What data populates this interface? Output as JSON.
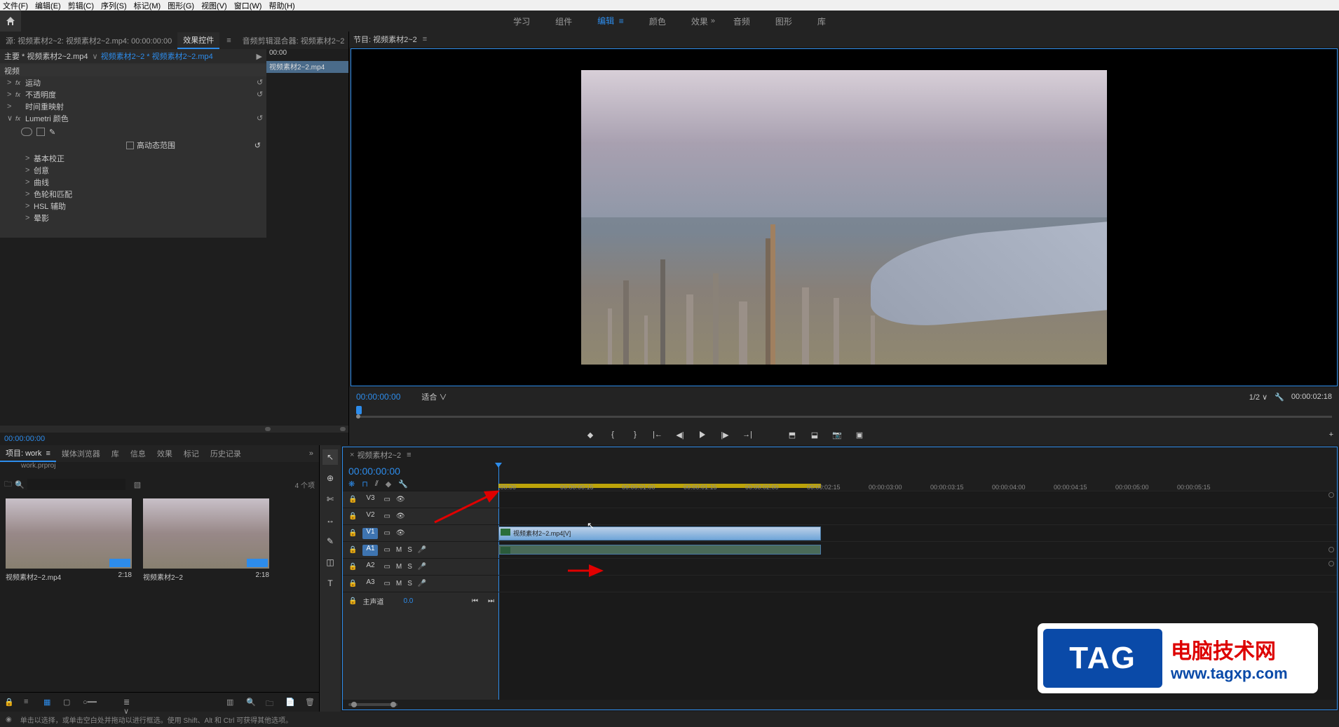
{
  "menubar": [
    "文件(F)",
    "编辑(E)",
    "剪辑(C)",
    "序列(S)",
    "标记(M)",
    "图形(G)",
    "视图(V)",
    "窗口(W)",
    "帮助(H)"
  ],
  "workspaces": {
    "items": [
      "学习",
      "组件",
      "编辑",
      "颜色",
      "效果",
      "音频",
      "图形",
      "库"
    ],
    "active": "编辑",
    "more": "»"
  },
  "source_tabs": {
    "source": "源: 视频素材2~2: 视频素材2~2.mp4: 00:00:00:00",
    "effect": "效果控件",
    "mixer": "音频剪辑混合器: 视频素材2~2",
    "more": "»"
  },
  "effect_header": {
    "master": "主要 * 视频素材2~2.mp4",
    "chevron": "∨",
    "link": "视频素材2~2 * 视频素材2~2.mp4",
    "play": "▶"
  },
  "side_tc": "00:00",
  "side_clip": "视频素材2~2.mp4",
  "effects": {
    "video_section": "视频",
    "rows": [
      {
        "fx": "fx",
        "label": "运动",
        "reset": "↺"
      },
      {
        "fx": "fx",
        "label": "不透明度",
        "reset": "↺"
      },
      {
        "fx": "",
        "label": "时间重映射"
      },
      {
        "fx": "fx",
        "label": "Lumetri 颜色",
        "reset": "↺",
        "expanded": true
      }
    ],
    "hdr_checkbox": "高动态范围",
    "hdr_reset": "↺",
    "lumetri_sub": [
      "基本校正",
      "创意",
      "曲线",
      "色轮和匹配",
      "HSL 辅助",
      "晕影"
    ]
  },
  "source_tc": "00:00:00:00",
  "program_tab": "节目: 视频素材2~2",
  "program_menu": "≡",
  "program_controls": {
    "tc": "00:00:00:00",
    "fit": "适合",
    "fit_chev": "∨",
    "res": "1/2",
    "res_chev": "∨",
    "dur": "00:00:02:18"
  },
  "transport_icons": [
    "marker-in",
    "bracket-l",
    "bracket-r",
    "goto-in",
    "step-back",
    "play",
    "step-fwd",
    "goto-out",
    "lift",
    "extract",
    "snapshot",
    "export"
  ],
  "add_plus": "+",
  "project_tabs": [
    "项目: work",
    "媒体浏览器",
    "库",
    "信息",
    "效果",
    "标记",
    "历史记录"
  ],
  "project_more": "»",
  "project_file": "work.prproj",
  "item_count": "4 个项",
  "bin_icon": "🗀",
  "clips": [
    {
      "name": "视频素材2~2.mp4",
      "dur": "2:18"
    },
    {
      "name": "视频素材2~2",
      "dur": "2:18"
    }
  ],
  "timeline": {
    "tab": "视频素材2~2",
    "menu": "≡",
    "tc": "00:00:00:00",
    "tool_icons": [
      "❋",
      "⊓",
      "⫽",
      "◆",
      "🔧"
    ],
    "ticks": [
      ":00:00",
      "00:00:00:15",
      "00:00:01:00",
      "00:00:01:15",
      "00:00:02:00",
      "00:00:02:15",
      "00:00:03:00",
      "00:00:03:15",
      "00:00:04:00",
      "00:00:04:15",
      "00:00:05:00",
      "00:00:05:15"
    ],
    "tracks_v": [
      "V3",
      "V2",
      "V1"
    ],
    "tracks_a": [
      "A1",
      "A2",
      "A3"
    ],
    "master": "主声道",
    "master_val": "0.0",
    "clip_label": "视频素材2~2.mp4[V]"
  },
  "tl_tools": [
    "↖",
    "⊕",
    "✄",
    "↔",
    "✎",
    "◫",
    "T"
  ],
  "statusbar": {
    "info": "◉",
    "text": "单击以选择，或单击空白处并拖动以进行框选。使用 Shift、Alt 和 Ctrl 可获得其他选项。"
  },
  "watermark": {
    "tag": "TAG",
    "line1": "电脑技术网",
    "line2": "www.tagxp.com"
  }
}
